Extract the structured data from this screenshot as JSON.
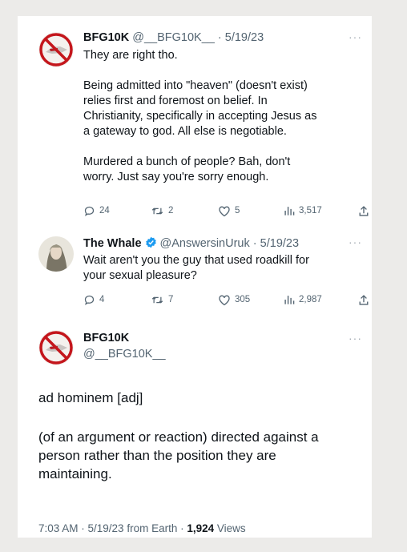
{
  "tweet1": {
    "name": "BFG10K",
    "handle": "@__BFG10K__",
    "sep": "·",
    "date": "5/19/23",
    "text": "They are right tho.\n\nBeing admitted into \"heaven\" (doesn't exist)\nrelies first and foremost on belief. In\nChristianity, specifically in accepting Jesus as\na gateway to god. All else is negotiable.\n\nMurdered a bunch of people? Bah, don't\nworry. Just say you're sorry enough.",
    "replies": "24",
    "retweets": "2",
    "likes": "5",
    "views": "3,517"
  },
  "tweet2": {
    "name": "The Whale",
    "handle": "@AnswersinUruk",
    "sep": "·",
    "date": "5/19/23",
    "text": "Wait aren't you the guy that used roadkill for\nyour sexual pleasure?",
    "replies": "4",
    "retweets": "7",
    "likes": "305",
    "views": "2,987"
  },
  "tweet3": {
    "name": "BFG10K",
    "handle": "@__BFG10K__",
    "line1": "ad hominem [adj]",
    "line2": "(of an argument or reaction) directed against a\nperson rather than the position they are\nmaintaining.",
    "time": "7:03 AM · 5/19/23 from Earth · ",
    "views_count": "1,924",
    "views_label": " Views"
  },
  "more_label": "···",
  "colors": {
    "verified": "#1d9bf0",
    "muted": "#536471"
  }
}
